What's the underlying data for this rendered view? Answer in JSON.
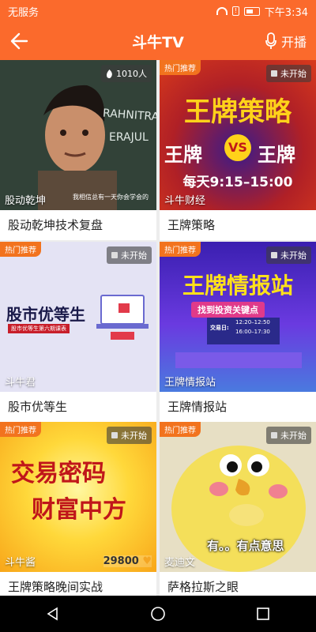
{
  "status": {
    "carrier": "无服务",
    "time": "下午3:34",
    "sim_glyph": "!"
  },
  "appbar": {
    "title": "斗牛TV",
    "live_label": "开播"
  },
  "cards": [
    {
      "caption": "股动乾坤技术复盘",
      "owner": "股动乾坤",
      "badge": "1010人",
      "hot": "",
      "overlay": [
        "RAHNITRA",
        "ERAJUL",
        "我相信总有一天你会学会的"
      ]
    },
    {
      "caption": "王牌策略",
      "owner": "斗牛财经",
      "badge": "未开始",
      "hot": "热门推荐",
      "overlay": [
        "王牌策略",
        "王牌",
        "VS",
        "王牌",
        "每天9:15–15:00"
      ]
    },
    {
      "caption": "股市优等生",
      "owner": "斗牛君",
      "badge": "未开始",
      "hot": "热门推荐",
      "overlay": [
        "股市优等生",
        "股市优等生第六期课表"
      ]
    },
    {
      "caption": "王牌情报站",
      "owner": "王牌情报站",
      "badge": "未开始",
      "hot": "热门推荐",
      "overlay": [
        "王牌情报站",
        "找到投资关键点",
        "交易日:",
        "12:20–12:50",
        "16:00–17:30"
      ]
    },
    {
      "caption": "王牌策略晚间实战",
      "owner": "斗牛酱",
      "badge": "未开始",
      "hot": "热门推荐",
      "count": "29800",
      "overlay": [
        "交易密码",
        "财富中方"
      ]
    },
    {
      "caption": "萨格拉斯之眼",
      "owner": "麦迪文",
      "badge": "未开始",
      "hot": "热门推荐",
      "overlay": [
        "有。。有点意思"
      ]
    }
  ],
  "colors": {
    "accent": "#fb6a2c",
    "hot_tag": "#f2731e"
  }
}
